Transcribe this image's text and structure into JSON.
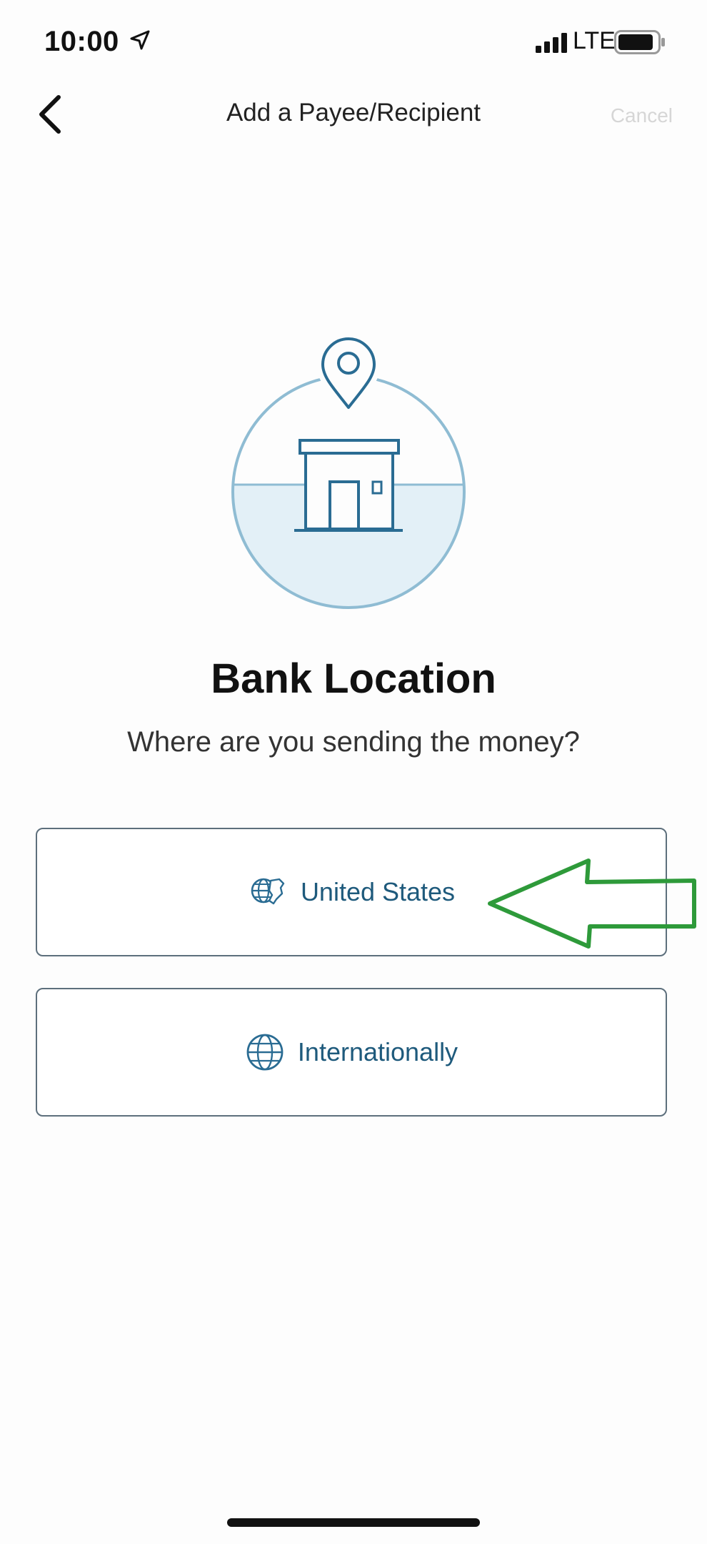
{
  "status_bar": {
    "time": "10:00",
    "network": "LTE",
    "icons": [
      "location-arrow-icon",
      "signal-icon",
      "battery-icon"
    ]
  },
  "nav": {
    "back_icon": "chevron-left-icon",
    "title": "Add a Payee/Recipient",
    "cancel_label": "Cancel"
  },
  "hero": {
    "icon": "bank-location-illustration",
    "colors": {
      "stroke": "#2a6c93",
      "circle": "#8fbcd3",
      "fill": "#e3f0f7"
    }
  },
  "main": {
    "heading": "Bank Location",
    "subheading": "Where are you sending the money?",
    "options": [
      {
        "label": "United States",
        "icon": "us-globe-icon"
      },
      {
        "label": "Internationally",
        "icon": "globe-icon"
      }
    ]
  },
  "annotation": {
    "type": "arrow",
    "color": "#2e9a3a",
    "points_to": "United States"
  },
  "colors": {
    "option_border": "#5d6f7c",
    "option_text": "#1e5a7c",
    "background": "#fdfdfd"
  }
}
